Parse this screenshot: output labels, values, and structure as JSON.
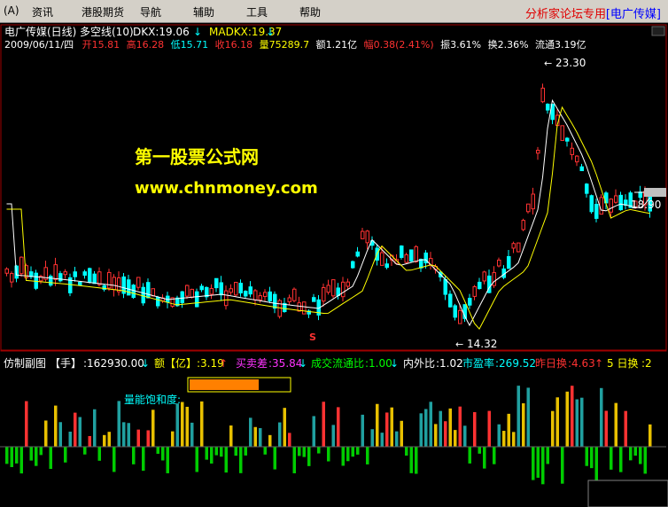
{
  "menu": {
    "items": [
      "(A)",
      "资讯",
      "港股期货",
      "导航",
      "辅助",
      "工具",
      "帮助"
    ],
    "brand_label": "分析家论坛专用",
    "brand_stock": "[电广传媒]"
  },
  "header": {
    "title": "电广传媒(日线)",
    "indicator_name": "多空线(10)",
    "dkx": "DKX:19.06",
    "madkx": "MADKX:19.37",
    "date": "2009/06/11/四",
    "open_label": "开",
    "open": "15.81",
    "high_label": "高",
    "high": "16.28",
    "low_label": "低",
    "low": "15.71",
    "close_label": "收",
    "close": "16.18",
    "vol_label": "量",
    "vol": "75289.7",
    "amount": "额1.21亿",
    "change_label": "幅",
    "change": "0.38(2.41%)",
    "amplitude": "振3.61%",
    "turnover": "换2.36%",
    "float": "流通3.19亿"
  },
  "watermark": {
    "line1": "第一股票公式网",
    "line2": "www.chnmoney.com"
  },
  "annotations": {
    "high_price": "23.30",
    "low_price": "14.32",
    "current_price": "18.90",
    "marker": "S"
  },
  "sub": {
    "name": "仿制副图",
    "hand_label": "【手】",
    "hand_value": ":162930.00",
    "amount_label": "额【亿】",
    "amount_value": ":3.19",
    "bs_label": "买卖差",
    "bs_value": ":35.84",
    "fc_label": "成交流通比",
    "fc_value": ":1.00",
    "nw_label": "内外比",
    "nw_value": ":1.02",
    "pe_label": "市盈率",
    "pe_value": ":269.52",
    "yday_label": "昨日换",
    "yday_value": ":4.63",
    "five_label": "5 日换",
    "five_value": ":2",
    "saturation_label": "量能饱和度:"
  },
  "colors": {
    "up": "#ff3232",
    "down": "#00ffff",
    "yellow_line": "#ffff00",
    "white_line": "#ffffff",
    "grid": "#a00000",
    "green_vol": "#00cc00",
    "gold_vol": "#e8c000",
    "teal_vol": "#20a0a0"
  }
}
